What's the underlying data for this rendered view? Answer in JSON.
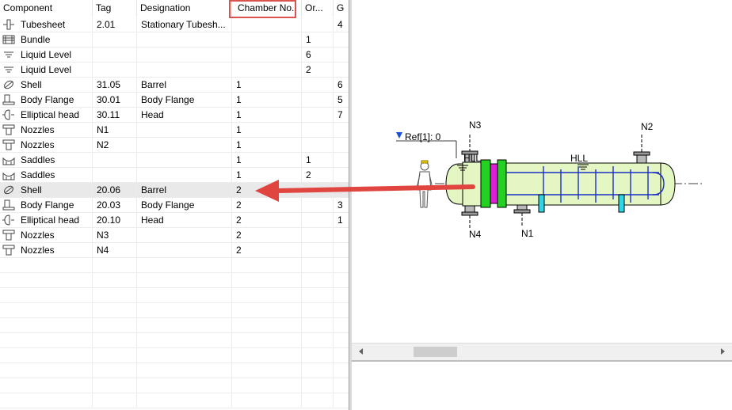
{
  "columns": [
    "Component",
    "Tag",
    "Designation",
    "Chamber No.",
    "Or...",
    "G"
  ],
  "rows": [
    {
      "icon": "tubesheet-icon",
      "component": "Tubesheet",
      "tag": "2.01",
      "designation": "Stationary Tubesh...",
      "chamber": "",
      "or": "",
      "g": "4"
    },
    {
      "icon": "bundle-icon",
      "component": "Bundle",
      "tag": "",
      "designation": "",
      "chamber": "",
      "or": "1",
      "g": ""
    },
    {
      "icon": "liquid-level-icon",
      "component": "Liquid Level",
      "tag": "",
      "designation": "",
      "chamber": "",
      "or": "6",
      "g": ""
    },
    {
      "icon": "liquid-level-icon",
      "component": "Liquid Level",
      "tag": "",
      "designation": "",
      "chamber": "",
      "or": "2",
      "g": ""
    },
    {
      "icon": "shell-icon",
      "component": "Shell",
      "tag": "31.05",
      "designation": "Barrel",
      "chamber": "1",
      "or": "",
      "g": "6"
    },
    {
      "icon": "body-flange-icon",
      "component": "Body Flange",
      "tag": "30.01",
      "designation": "Body Flange",
      "chamber": "1",
      "or": "",
      "g": "5"
    },
    {
      "icon": "elliptical-head-icon",
      "component": "Elliptical head",
      "tag": "30.11",
      "designation": "Head",
      "chamber": "1",
      "or": "",
      "g": "7"
    },
    {
      "icon": "nozzle-icon",
      "component": "Nozzles",
      "tag": "N1",
      "designation": "",
      "chamber": "1",
      "or": "",
      "g": ""
    },
    {
      "icon": "nozzle-icon",
      "component": "Nozzles",
      "tag": "N2",
      "designation": "",
      "chamber": "1",
      "or": "",
      "g": ""
    },
    {
      "icon": "saddle-icon",
      "component": "Saddles",
      "tag": "",
      "designation": "",
      "chamber": "1",
      "or": "1",
      "g": ""
    },
    {
      "icon": "saddle-icon",
      "component": "Saddles",
      "tag": "",
      "designation": "",
      "chamber": "1",
      "or": "2",
      "g": ""
    },
    {
      "icon": "shell-icon",
      "component": "Shell",
      "tag": "20.06",
      "designation": "Barrel",
      "chamber": "2",
      "or": "",
      "g": ""
    },
    {
      "icon": "body-flange-icon",
      "component": "Body Flange",
      "tag": "20.03",
      "designation": "Body Flange",
      "chamber": "2",
      "or": "",
      "g": "3"
    },
    {
      "icon": "elliptical-head-icon",
      "component": "Elliptical head",
      "tag": "20.10",
      "designation": "Head",
      "chamber": "2",
      "or": "",
      "g": "1"
    },
    {
      "icon": "nozzle-icon",
      "component": "Nozzles",
      "tag": "N3",
      "designation": "",
      "chamber": "2",
      "or": "",
      "g": ""
    },
    {
      "icon": "nozzle-icon",
      "component": "Nozzles",
      "tag": "N4",
      "designation": "",
      "chamber": "2",
      "or": "",
      "g": ""
    }
  ],
  "selected_row": 11,
  "highlighted_column": "Chamber No.",
  "drawing": {
    "ref_label": "Ref[1]: 0",
    "nozzle_labels": [
      "N3",
      "N2",
      "N4",
      "N1"
    ],
    "hll_labels": [
      "HLL",
      "HLL"
    ]
  },
  "colors": {
    "highlight_box": "#d9534f",
    "arrow": "#e0463f",
    "shell_fill": "#e4f7c2",
    "flange_green": "#22d122",
    "flange_magenta": "#e020d8",
    "nozzle_cyan": "#2fd6e6",
    "baffle_blue": "#1a2fc8"
  }
}
